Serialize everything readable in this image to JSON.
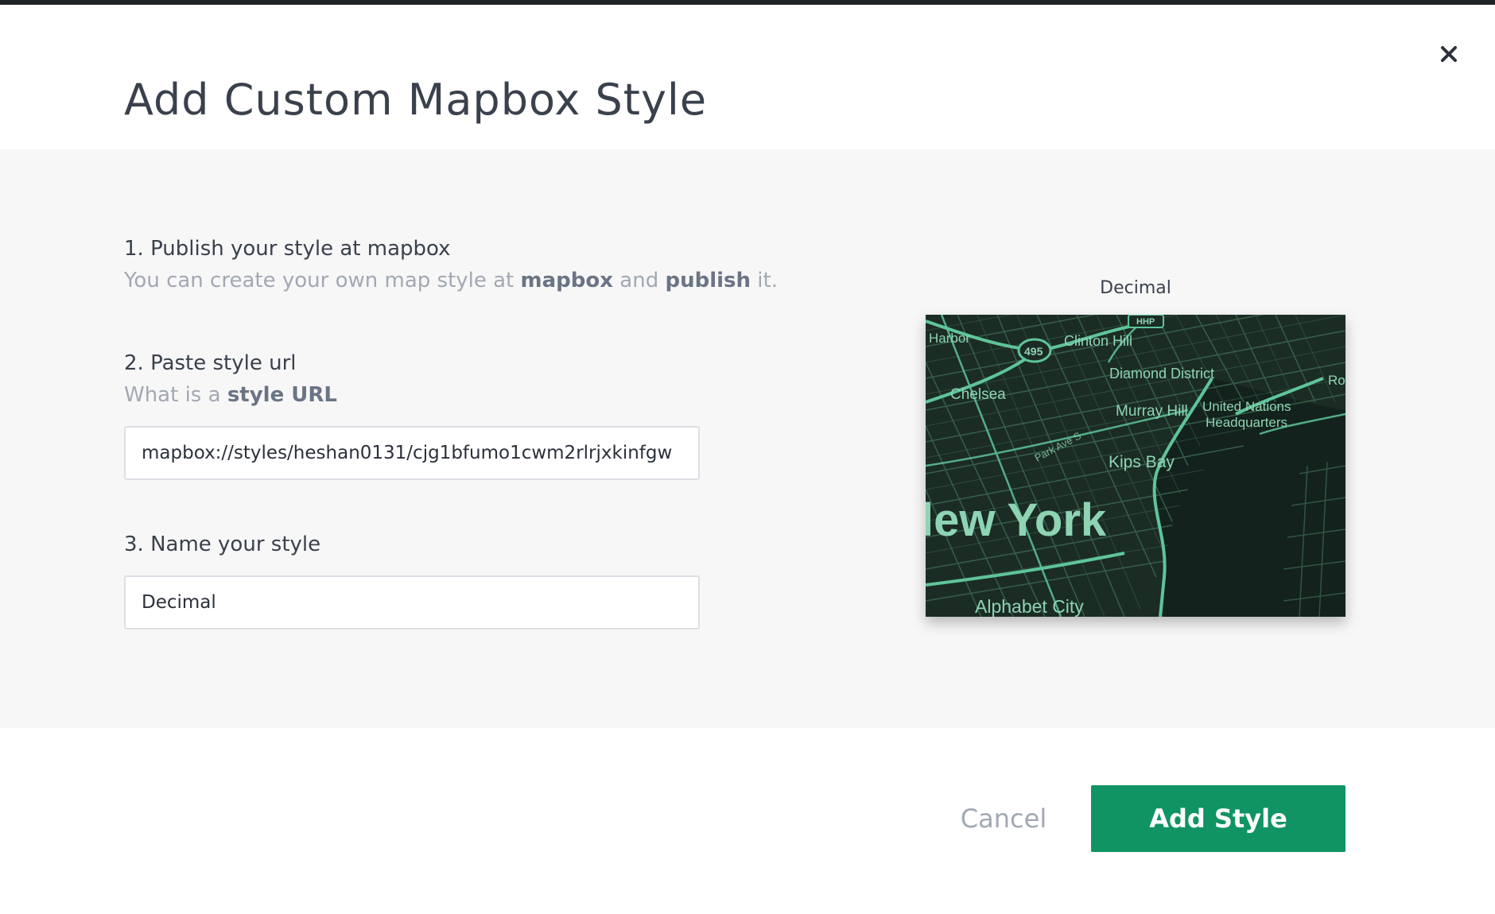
{
  "modal": {
    "title": "Add Custom Mapbox Style",
    "close_icon": "close-icon"
  },
  "step1": {
    "title": "1. Publish your style at mapbox",
    "desc_prefix": "You can create your own map style at ",
    "link_mapbox": "mapbox",
    "desc_middle": " and ",
    "link_publish": "publish",
    "desc_suffix": " it."
  },
  "step2": {
    "title": "2. Paste style url",
    "desc_prefix": "What is a ",
    "link_style_url": "style URL",
    "input_value": "mapbox://styles/heshan0131/cjg1bfumo1cwm2rlrjxkinfgw"
  },
  "step3": {
    "title": "3. Name your style",
    "input_value": "Decimal"
  },
  "preview": {
    "label": "Decimal",
    "map_labels": {
      "harbor": "Harbor",
      "clinton_hill": "Clinton Hill",
      "highway_shield": "495",
      "hhp": "HHP",
      "diamond_district": "Diamond District",
      "ro": "Ro",
      "chelsea": "Chelsea",
      "murray_hill": "Murray Hill",
      "un_line1": "United Nations",
      "un_line2": "Headquarters",
      "park_ave": "Park Ave S",
      "kips_bay": "Kips Bay",
      "new_york": "lew York",
      "alphabet_city": "Alphabet City"
    },
    "colors": {
      "land": "#1b2c24",
      "road": "#3f6b55",
      "major_road": "#5fc49a",
      "label": "#8ed4b4",
      "water": "#13221c"
    }
  },
  "footer": {
    "cancel_label": "Cancel",
    "add_label": "Add Style"
  },
  "colors": {
    "accent": "#109463",
    "panel_bg": "#f7f7f7",
    "muted_text": "#a2a8b3",
    "link_text": "#6a7485"
  }
}
